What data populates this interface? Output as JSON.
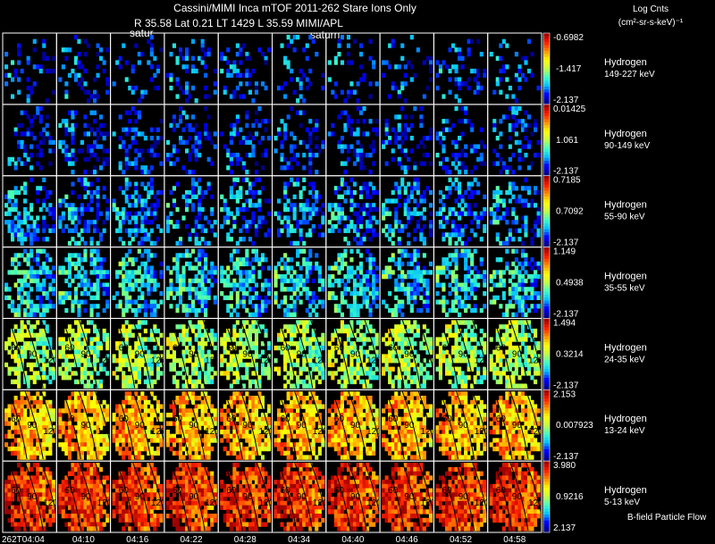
{
  "header": {
    "title": "Cassini/MIMI Inca mTOF  2011-262    Stare    Ions Only",
    "subtitle": "R        35.58 Lat 0.21 LT 1429 L          35.59  MIMI/APL",
    "saturn_labels": [
      "satur",
      "saturn"
    ]
  },
  "legend": {
    "units_line1": "Log Cnts",
    "units_line2": "(cm²-sr-s-keV)⁻¹",
    "flow_note": "B-field Particle Flow"
  },
  "colors": {
    "background": "#000000",
    "text": "#ffffff",
    "grid": "#ffffff",
    "colormap": [
      "#000080",
      "#0000ff",
      "#00c0ff",
      "#40ffc0",
      "#c0ff40",
      "#ffff00",
      "#ff9000",
      "#ff2000",
      "#a00000"
    ]
  },
  "chart_data": {
    "type": "heatmap",
    "x_label_prefix": "262T",
    "time_labels": [
      "04:04",
      "04:10",
      "04:16",
      "04:22",
      "04:28",
      "04:34",
      "04:40",
      "04:46",
      "04:52",
      "04:58"
    ],
    "pitch_angle_contours": [
      "30",
      "60",
      "90",
      "120"
    ],
    "rows": [
      {
        "species": "Hydrogen",
        "energy": "149-227 keV",
        "cbar_max": "-0.6982",
        "cbar_mid": "-1.417",
        "cbar_min": "-2.137",
        "mean_level": 0.16,
        "fill": 0.22
      },
      {
        "species": "Hydrogen",
        "energy": "90-149 keV",
        "cbar_max": "0.01425",
        "cbar_mid": "1.061",
        "cbar_min": "-2.137",
        "mean_level": 0.14,
        "fill": 0.32
      },
      {
        "species": "Hydrogen",
        "energy": "55-90 keV",
        "cbar_max": "0.7185",
        "cbar_mid": "0.7092",
        "cbar_min": "-2.137",
        "mean_level": 0.22,
        "fill": 0.5
      },
      {
        "species": "Hydrogen",
        "energy": "35-55 keV",
        "cbar_max": "1.149",
        "cbar_mid": "0.4938",
        "cbar_min": "-2.137",
        "mean_level": 0.3,
        "fill": 0.62
      },
      {
        "species": "Hydrogen",
        "energy": "24-35 keV",
        "cbar_max": "1.494",
        "cbar_mid": "0.3214",
        "cbar_min": "-2.137",
        "mean_level": 0.48,
        "fill": 0.72
      },
      {
        "species": "Hydrogen",
        "energy": "13-24 keV",
        "cbar_max": "2.153",
        "cbar_mid": "0.007923",
        "cbar_min": "-2.137",
        "mean_level": 0.7,
        "fill": 0.92
      },
      {
        "species": "Hydrogen",
        "energy": "5-13 keV",
        "cbar_max": "3.980",
        "cbar_mid": "0.9216",
        "cbar_min": "2.137",
        "mean_level": 0.86,
        "fill": 0.98
      }
    ]
  }
}
